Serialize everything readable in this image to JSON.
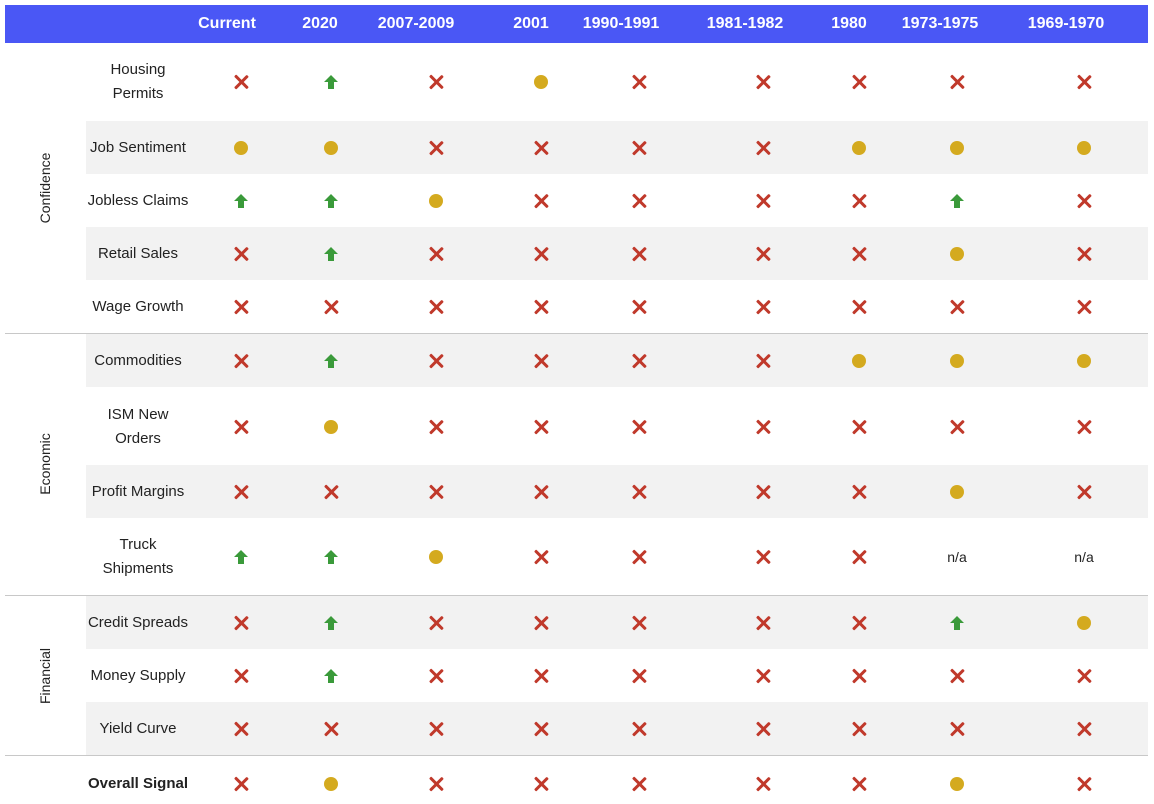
{
  "columns": [
    "Current",
    "2020",
    "2007-2009",
    "2001",
    "1990-1991",
    "1981-1982",
    "1980",
    "1973-1975",
    "1969-1970"
  ],
  "groups": [
    "Confidence",
    "Economic",
    "Financial"
  ],
  "legend_icons": {
    "x": "x-icon",
    "dot": "dot-icon",
    "up": "arrow-up-icon"
  },
  "colors": {
    "header": "#4a57f5",
    "x": "#c0392b",
    "dot": "#d4aa1f",
    "up": "#3a9a3a",
    "stripe": "#f2f2f2"
  },
  "rows": [
    {
      "label": "Housing Permits",
      "cells": [
        "x",
        "up",
        "x",
        "dot",
        "x",
        "x",
        "x",
        "x",
        "x"
      ]
    },
    {
      "label": "Job Sentiment",
      "cells": [
        "dot",
        "dot",
        "x",
        "x",
        "x",
        "x",
        "dot",
        "dot",
        "dot"
      ]
    },
    {
      "label": "Jobless Claims",
      "cells": [
        "up",
        "up",
        "dot",
        "x",
        "x",
        "x",
        "x",
        "up",
        "x"
      ]
    },
    {
      "label": "Retail Sales",
      "cells": [
        "x",
        "up",
        "x",
        "x",
        "x",
        "x",
        "x",
        "dot",
        "x"
      ]
    },
    {
      "label": "Wage Growth",
      "cells": [
        "x",
        "x",
        "x",
        "x",
        "x",
        "x",
        "x",
        "x",
        "x"
      ]
    },
    {
      "label": "Commodities",
      "cells": [
        "x",
        "up",
        "x",
        "x",
        "x",
        "x",
        "dot",
        "dot",
        "dot"
      ]
    },
    {
      "label": "ISM New Orders",
      "cells": [
        "x",
        "dot",
        "x",
        "x",
        "x",
        "x",
        "x",
        "x",
        "x"
      ]
    },
    {
      "label": "Profit Margins",
      "cells": [
        "x",
        "x",
        "x",
        "x",
        "x",
        "x",
        "x",
        "dot",
        "x"
      ]
    },
    {
      "label": "Truck Shipments",
      "cells": [
        "up",
        "up",
        "dot",
        "x",
        "x",
        "x",
        "x",
        "n/a",
        "n/a"
      ]
    },
    {
      "label": "Credit Spreads",
      "cells": [
        "x",
        "up",
        "x",
        "x",
        "x",
        "x",
        "x",
        "up",
        "dot"
      ]
    },
    {
      "label": "Money Supply",
      "cells": [
        "x",
        "up",
        "x",
        "x",
        "x",
        "x",
        "x",
        "x",
        "x"
      ]
    },
    {
      "label": "Yield Curve",
      "cells": [
        "x",
        "x",
        "x",
        "x",
        "x",
        "x",
        "x",
        "x",
        "x"
      ]
    },
    {
      "label": "Overall Signal",
      "cells": [
        "x",
        "dot",
        "x",
        "x",
        "x",
        "x",
        "x",
        "dot",
        "x"
      ]
    }
  ]
}
